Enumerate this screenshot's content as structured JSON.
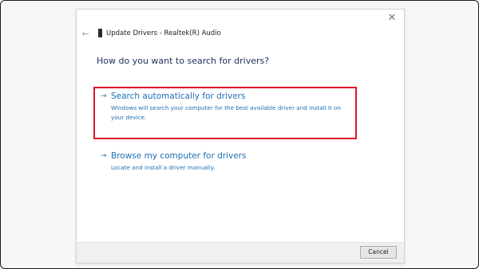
{
  "window": {
    "title": "Update Drivers - Realtek(R) Audio",
    "close_glyph": "✕",
    "back_glyph": "←",
    "device_icon": "speaker-device-icon"
  },
  "main": {
    "heading": "How do you want to search for drivers?",
    "options": [
      {
        "arrow": "→",
        "title": "Search automatically for drivers",
        "description": "Windows will search your computer for the best available driver and install it on your device.",
        "highlighted": true
      },
      {
        "arrow": "→",
        "title": "Browse my computer for drivers",
        "description": "Locate and install a driver manually.",
        "highlighted": false
      }
    ]
  },
  "footer": {
    "cancel_label": "Cancel"
  },
  "colors": {
    "link": "#1f6fb2",
    "heading": "#1b2e5c",
    "highlight": "#e0152a"
  }
}
